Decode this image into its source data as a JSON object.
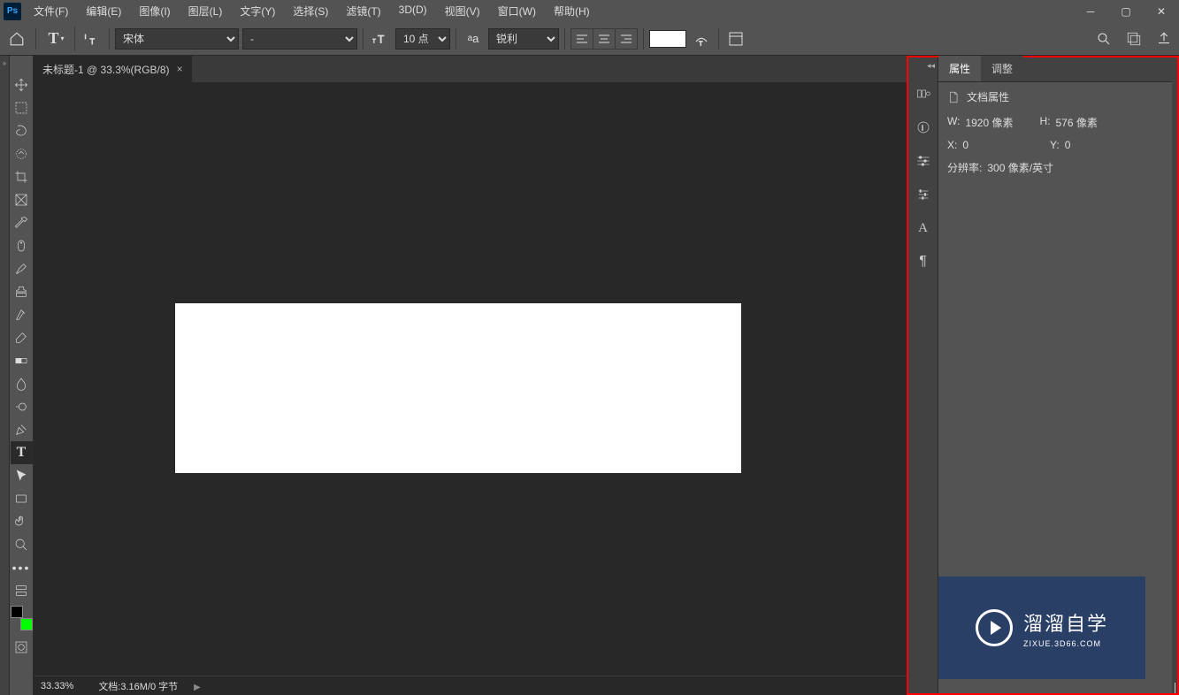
{
  "app": {
    "short": "Ps"
  },
  "menubar": [
    "文件(F)",
    "编辑(E)",
    "图像(I)",
    "图层(L)",
    "文字(Y)",
    "选择(S)",
    "滤镜(T)",
    "3D(D)",
    "视图(V)",
    "窗口(W)",
    "帮助(H)"
  ],
  "options": {
    "font": "宋体",
    "style": "-",
    "size": "10 点",
    "aa_mode": "锐利"
  },
  "document": {
    "tab_label": "未标题-1 @ 33.3%(RGB/8)"
  },
  "statusbar": {
    "zoom": "33.33%",
    "docinfo": "文档:3.16M/0 字节"
  },
  "panels": {
    "tabs": {
      "properties": "属性",
      "adjustments": "调整"
    },
    "doc_properties_title": "文档属性",
    "w_label": "W:",
    "w_value": "1920 像素",
    "h_label": "H:",
    "h_value": "576 像素",
    "x_label": "X:",
    "x_value": "0",
    "y_label": "Y:",
    "y_value": "0",
    "res_label": "分辨率: ",
    "res_value": "300 像素/英寸"
  },
  "watermark": {
    "main": "溜溜自学",
    "sub": "ZIXUE.3D66.COM"
  }
}
